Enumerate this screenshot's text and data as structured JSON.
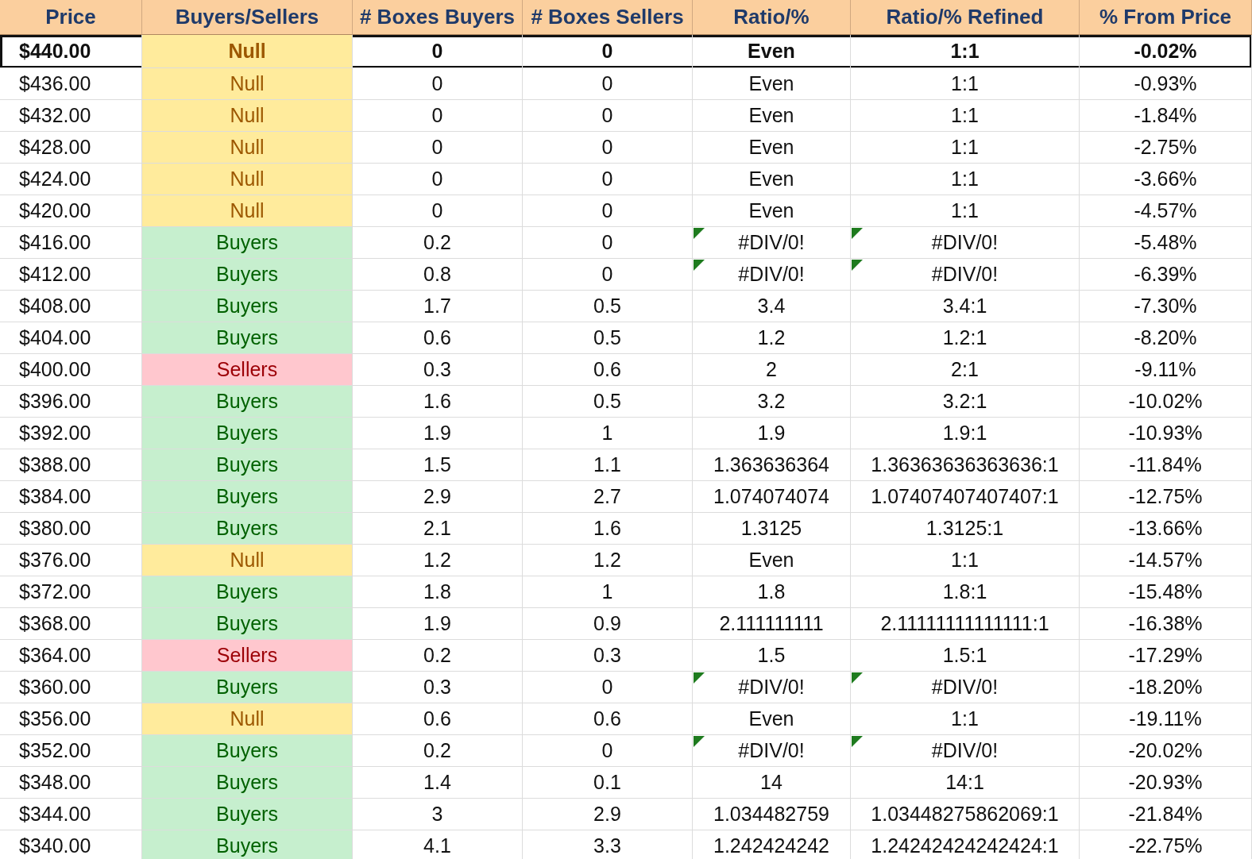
{
  "table": {
    "columns": [
      "Price",
      "Buyers/Sellers",
      "# Boxes Buyers",
      "# Boxes Sellers",
      "Ratio/%",
      "Ratio/% Refined",
      "% From Price"
    ],
    "rows": [
      {
        "price": "$440.00",
        "side": {
          "kind": "null",
          "label": "Null"
        },
        "boxes_buyers": "0",
        "boxes_sellers": "0",
        "ratio": "Even",
        "ratio_refined": "1:1",
        "from_price": "-0.02%",
        "flagged": false,
        "selected": true
      },
      {
        "price": "$436.00",
        "side": {
          "kind": "null",
          "label": "Null"
        },
        "boxes_buyers": "0",
        "boxes_sellers": "0",
        "ratio": "Even",
        "ratio_refined": "1:1",
        "from_price": "-0.93%",
        "flagged": false,
        "selected": false
      },
      {
        "price": "$432.00",
        "side": {
          "kind": "null",
          "label": "Null"
        },
        "boxes_buyers": "0",
        "boxes_sellers": "0",
        "ratio": "Even",
        "ratio_refined": "1:1",
        "from_price": "-1.84%",
        "flagged": false,
        "selected": false
      },
      {
        "price": "$428.00",
        "side": {
          "kind": "null",
          "label": "Null"
        },
        "boxes_buyers": "0",
        "boxes_sellers": "0",
        "ratio": "Even",
        "ratio_refined": "1:1",
        "from_price": "-2.75%",
        "flagged": false,
        "selected": false
      },
      {
        "price": "$424.00",
        "side": {
          "kind": "null",
          "label": "Null"
        },
        "boxes_buyers": "0",
        "boxes_sellers": "0",
        "ratio": "Even",
        "ratio_refined": "1:1",
        "from_price": "-3.66%",
        "flagged": false,
        "selected": false
      },
      {
        "price": "$420.00",
        "side": {
          "kind": "null",
          "label": "Null"
        },
        "boxes_buyers": "0",
        "boxes_sellers": "0",
        "ratio": "Even",
        "ratio_refined": "1:1",
        "from_price": "-4.57%",
        "flagged": false,
        "selected": false
      },
      {
        "price": "$416.00",
        "side": {
          "kind": "buyers",
          "label": "Buyers"
        },
        "boxes_buyers": "0.2",
        "boxes_sellers": "0",
        "ratio": "#DIV/0!",
        "ratio_refined": "#DIV/0!",
        "from_price": "-5.48%",
        "flagged": true,
        "selected": false
      },
      {
        "price": "$412.00",
        "side": {
          "kind": "buyers",
          "label": "Buyers"
        },
        "boxes_buyers": "0.8",
        "boxes_sellers": "0",
        "ratio": "#DIV/0!",
        "ratio_refined": "#DIV/0!",
        "from_price": "-6.39%",
        "flagged": true,
        "selected": false
      },
      {
        "price": "$408.00",
        "side": {
          "kind": "buyers",
          "label": "Buyers"
        },
        "boxes_buyers": "1.7",
        "boxes_sellers": "0.5",
        "ratio": "3.4",
        "ratio_refined": "3.4:1",
        "from_price": "-7.30%",
        "flagged": false,
        "selected": false
      },
      {
        "price": "$404.00",
        "side": {
          "kind": "buyers",
          "label": "Buyers"
        },
        "boxes_buyers": "0.6",
        "boxes_sellers": "0.5",
        "ratio": "1.2",
        "ratio_refined": "1.2:1",
        "from_price": "-8.20%",
        "flagged": false,
        "selected": false
      },
      {
        "price": "$400.00",
        "side": {
          "kind": "sellers",
          "label": "Sellers"
        },
        "boxes_buyers": "0.3",
        "boxes_sellers": "0.6",
        "ratio": "2",
        "ratio_refined": "2:1",
        "from_price": "-9.11%",
        "flagged": false,
        "selected": false
      },
      {
        "price": "$396.00",
        "side": {
          "kind": "buyers",
          "label": "Buyers"
        },
        "boxes_buyers": "1.6",
        "boxes_sellers": "0.5",
        "ratio": "3.2",
        "ratio_refined": "3.2:1",
        "from_price": "-10.02%",
        "flagged": false,
        "selected": false
      },
      {
        "price": "$392.00",
        "side": {
          "kind": "buyers",
          "label": "Buyers"
        },
        "boxes_buyers": "1.9",
        "boxes_sellers": "1",
        "ratio": "1.9",
        "ratio_refined": "1.9:1",
        "from_price": "-10.93%",
        "flagged": false,
        "selected": false
      },
      {
        "price": "$388.00",
        "side": {
          "kind": "buyers",
          "label": "Buyers"
        },
        "boxes_buyers": "1.5",
        "boxes_sellers": "1.1",
        "ratio": "1.363636364",
        "ratio_refined": "1.36363636363636:1",
        "from_price": "-11.84%",
        "flagged": false,
        "selected": false
      },
      {
        "price": "$384.00",
        "side": {
          "kind": "buyers",
          "label": "Buyers"
        },
        "boxes_buyers": "2.9",
        "boxes_sellers": "2.7",
        "ratio": "1.074074074",
        "ratio_refined": "1.07407407407407:1",
        "from_price": "-12.75%",
        "flagged": false,
        "selected": false
      },
      {
        "price": "$380.00",
        "side": {
          "kind": "buyers",
          "label": "Buyers"
        },
        "boxes_buyers": "2.1",
        "boxes_sellers": "1.6",
        "ratio": "1.3125",
        "ratio_refined": "1.3125:1",
        "from_price": "-13.66%",
        "flagged": false,
        "selected": false
      },
      {
        "price": "$376.00",
        "side": {
          "kind": "null",
          "label": "Null"
        },
        "boxes_buyers": "1.2",
        "boxes_sellers": "1.2",
        "ratio": "Even",
        "ratio_refined": "1:1",
        "from_price": "-14.57%",
        "flagged": false,
        "selected": false
      },
      {
        "price": "$372.00",
        "side": {
          "kind": "buyers",
          "label": "Buyers"
        },
        "boxes_buyers": "1.8",
        "boxes_sellers": "1",
        "ratio": "1.8",
        "ratio_refined": "1.8:1",
        "from_price": "-15.48%",
        "flagged": false,
        "selected": false
      },
      {
        "price": "$368.00",
        "side": {
          "kind": "buyers",
          "label": "Buyers"
        },
        "boxes_buyers": "1.9",
        "boxes_sellers": "0.9",
        "ratio": "2.111111111",
        "ratio_refined": "2.11111111111111:1",
        "from_price": "-16.38%",
        "flagged": false,
        "selected": false
      },
      {
        "price": "$364.00",
        "side": {
          "kind": "sellers",
          "label": "Sellers"
        },
        "boxes_buyers": "0.2",
        "boxes_sellers": "0.3",
        "ratio": "1.5",
        "ratio_refined": "1.5:1",
        "from_price": "-17.29%",
        "flagged": false,
        "selected": false
      },
      {
        "price": "$360.00",
        "side": {
          "kind": "buyers",
          "label": "Buyers"
        },
        "boxes_buyers": "0.3",
        "boxes_sellers": "0",
        "ratio": "#DIV/0!",
        "ratio_refined": "#DIV/0!",
        "from_price": "-18.20%",
        "flagged": true,
        "selected": false
      },
      {
        "price": "$356.00",
        "side": {
          "kind": "null",
          "label": "Null"
        },
        "boxes_buyers": "0.6",
        "boxes_sellers": "0.6",
        "ratio": "Even",
        "ratio_refined": "1:1",
        "from_price": "-19.11%",
        "flagged": false,
        "selected": false
      },
      {
        "price": "$352.00",
        "side": {
          "kind": "buyers",
          "label": "Buyers"
        },
        "boxes_buyers": "0.2",
        "boxes_sellers": "0",
        "ratio": "#DIV/0!",
        "ratio_refined": "#DIV/0!",
        "from_price": "-20.02%",
        "flagged": true,
        "selected": false
      },
      {
        "price": "$348.00",
        "side": {
          "kind": "buyers",
          "label": "Buyers"
        },
        "boxes_buyers": "1.4",
        "boxes_sellers": "0.1",
        "ratio": "14",
        "ratio_refined": "14:1",
        "from_price": "-20.93%",
        "flagged": false,
        "selected": false
      },
      {
        "price": "$344.00",
        "side": {
          "kind": "buyers",
          "label": "Buyers"
        },
        "boxes_buyers": "3",
        "boxes_sellers": "2.9",
        "ratio": "1.034482759",
        "ratio_refined": "1.03448275862069:1",
        "from_price": "-21.84%",
        "flagged": false,
        "selected": false
      },
      {
        "price": "$340.00",
        "side": {
          "kind": "buyers",
          "label": "Buyers"
        },
        "boxes_buyers": "4.1",
        "boxes_sellers": "3.3",
        "ratio": "1.242424242",
        "ratio_refined": "1.24242424242424:1",
        "from_price": "-22.75%",
        "flagged": false,
        "selected": false
      }
    ]
  }
}
